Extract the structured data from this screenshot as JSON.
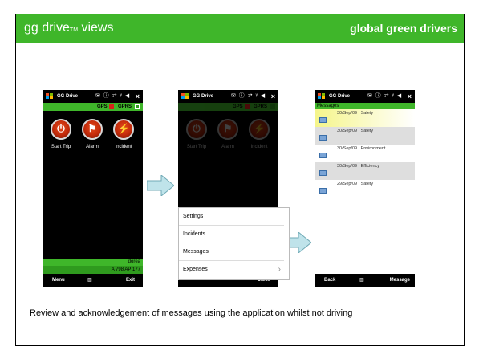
{
  "banner": {
    "brand_main": "gg drive",
    "brand_tm": "TM",
    "brand_suffix": " views",
    "tagline": "global green drivers",
    "color": "#3fb62a"
  },
  "phone1": {
    "app_title": "GG Drive",
    "status_icons": "✉ ⓘ ⇄ ᵞ ◀",
    "gps_label": "GPS",
    "gprs_label": "GPRS",
    "buttons": [
      {
        "label": "Start Trip",
        "icon": "power-icon",
        "glyph": "⏻"
      },
      {
        "label": "Alarm",
        "icon": "flag-icon",
        "glyph": "⚑"
      },
      {
        "label": "Incident",
        "icon": "lightning-icon",
        "glyph": "⚡"
      }
    ],
    "user": "dorea",
    "vehicle": "A 798 AP 177",
    "softkey_left": "Menu",
    "softkey_mid": "▥",
    "softkey_right": "Exit"
  },
  "phone2": {
    "app_title": "GG Drive",
    "status_icons": "✉ ⓘ ⇄ ᵞ ◀",
    "gps_label": "GPS",
    "gprs_label": "GPRS",
    "buttons": [
      {
        "label": "Start Trip",
        "glyph": "⏻"
      },
      {
        "label": "Alarm",
        "glyph": "⚑"
      },
      {
        "label": "Incident",
        "glyph": "⚡"
      }
    ],
    "menu_items": [
      "Settings",
      "Incidents",
      "Messages",
      "Expenses"
    ],
    "softkey_right": "Close"
  },
  "phone3": {
    "app_title": "GG Drive",
    "status_icons": "✉ ⓘ ⇄ ᵞ ◀",
    "header": "Messages",
    "messages": [
      {
        "text": "30/Sep/09 | Safety"
      },
      {
        "text": "30/Sep/09 | Safety"
      },
      {
        "text": "30/Sep/09 | Environment"
      },
      {
        "text": "30/Sep/09 | Efficiency"
      },
      {
        "text": "29/Sep/09 | Safety"
      }
    ],
    "softkey_left": "Back",
    "softkey_mid": "▥",
    "softkey_right": "Message"
  },
  "caption": "Review and acknowledgement of messages using the application whilst not driving"
}
